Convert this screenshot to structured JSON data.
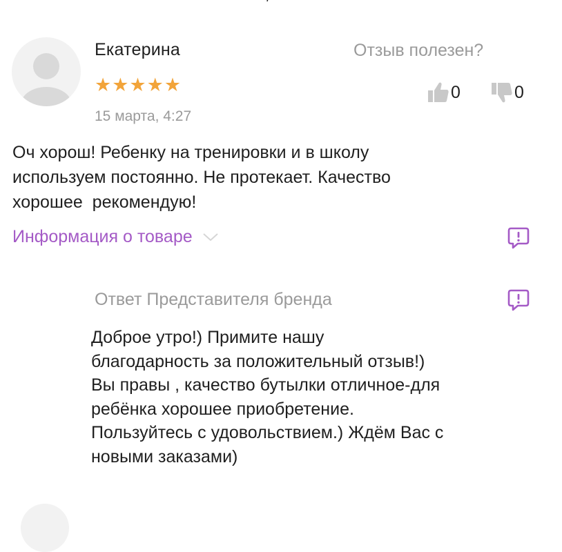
{
  "review": {
    "author": "Екатерина",
    "rating": 5,
    "stars_text": "★★★★★",
    "date": "15 марта, 4:27",
    "helpful_label": "Отзыв полезен?",
    "likes": "0",
    "dislikes": "0",
    "text": "Оч хорош! Ребенку на тренировки и в школу\nиспользуем постоянно. Не протекает. Качество\nхорошее  рекомендую!",
    "product_info_label": "Информация о товаре"
  },
  "brand_reply": {
    "title": "Ответ Представителя бренда",
    "text": "Доброе утро!) Примите нашу\nблагодарность за положительный отзыв!)\nВы правы , качество бутылки отличное-для\nребёнка хорошее приобретение.\nПользуйтесь с удовольствием.) Ждём Вас с\nновыми заказами)"
  },
  "icons": {
    "avatar": "user-avatar-placeholder",
    "like": "thumbs-up-icon",
    "dislike": "thumbs-down-icon",
    "expand": "chevron-down-icon",
    "report": "report-message-icon"
  },
  "colors": {
    "accent": "#a45ac6",
    "star": "#f2a43a",
    "muted": "#9a9a9a",
    "text": "#1f1f1f",
    "avatar_bg": "#f2f2f2",
    "avatar_fg": "#d9d9d9",
    "thumb": "#c8c8c8"
  }
}
